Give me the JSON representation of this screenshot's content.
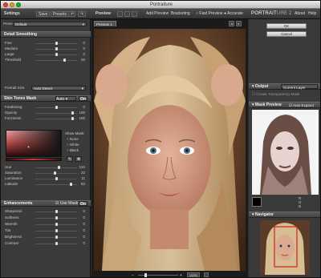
{
  "window": {
    "title": "Portraiture"
  },
  "toolbar": {
    "settings": "Settings",
    "save": "Save",
    "presets": "Presets",
    "preview": "Preview",
    "add_preview": "Add Preview",
    "bracketing": "Bracketing",
    "fast_preview": "Fast Preview",
    "accurate": "Accurate",
    "about": "About",
    "help": "Help"
  },
  "brand": {
    "name_a": "PORTRAIT",
    "name_b": "URE 2"
  },
  "preset": {
    "label": "Preset",
    "value": "Default"
  },
  "detail": {
    "title": "Detail Smoothing",
    "rows": [
      {
        "label": "Fine",
        "value": "0"
      },
      {
        "label": "Medium",
        "value": "0"
      },
      {
        "label": "Large",
        "value": "0"
      },
      {
        "label": "Threshold",
        "value": "20"
      }
    ],
    "portrait_size_label": "Portrait Size",
    "portrait_size_value": "Auto Detect"
  },
  "skin": {
    "title": "Skin Tones Mask",
    "mode": "Auto",
    "on": "On",
    "rows": [
      {
        "label": "Feathering",
        "value": "0"
      },
      {
        "label": "Opacity",
        "value": "100"
      },
      {
        "label": "Fuzziness",
        "value": "100"
      }
    ],
    "show_mask_label": "Show Mask:",
    "options": [
      "None",
      "White",
      "Black"
    ],
    "rows2": [
      {
        "label": "Hue",
        "value": "122"
      },
      {
        "label": "Saturation",
        "value": "22"
      },
      {
        "label": "Luminance",
        "value": "11"
      },
      {
        "label": "Latitude",
        "value": "82"
      }
    ]
  },
  "enh": {
    "title": "Enhancements",
    "use_mask": "Use Mask",
    "on": "On",
    "rows": [
      {
        "label": "Sharpness",
        "value": "0"
      },
      {
        "label": "Softness",
        "value": "0"
      },
      {
        "label": "Warmth",
        "value": "0"
      },
      {
        "label": "Tint",
        "value": "0"
      },
      {
        "label": "Brightness",
        "value": "0"
      },
      {
        "label": "Contrast",
        "value": "0"
      }
    ]
  },
  "preview_tab": "Preview 1",
  "zoom": "100%",
  "right": {
    "ok": "OK",
    "cancel": "Cancel",
    "output": "Output",
    "output_value": "Current Layer",
    "transparency": "Create Transparency Mask",
    "mask_preview": "Mask Preview",
    "auto_expand": "Auto Expand",
    "navigator": "Navigator",
    "rgb": [
      "R",
      "G",
      "B"
    ]
  },
  "colors": {
    "accent": "#cc2222",
    "swatch_dark": "#3a0c0c",
    "knob": "#dddddd"
  }
}
